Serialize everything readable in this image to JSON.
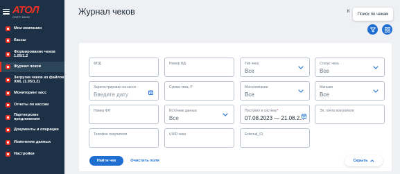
{
  "sidebar": {
    "logo": {
      "main": "АТОЛ",
      "sub": "СБЕР БАНК"
    },
    "items": [
      {
        "label": "Мои компании",
        "icon": "building-icon"
      },
      {
        "label": "Кассы",
        "icon": "register-icon"
      },
      {
        "label": "Формирование чеков 1.05/1.2",
        "icon": "receipt-create-icon"
      },
      {
        "label": "Журнал чеков",
        "icon": "journal-icon",
        "active": true
      },
      {
        "label": "Загрузка чеков из файлов XML (1.05/1.2)",
        "icon": "upload-icon"
      },
      {
        "label": "Мониторинг касс",
        "icon": "monitor-icon"
      },
      {
        "label": "Отчеты по кассам",
        "icon": "report-icon"
      },
      {
        "label": "Партнерские предложения",
        "icon": "partner-icon"
      },
      {
        "label": "Документы и операции",
        "icon": "documents-icon"
      },
      {
        "label": "Изменение данных",
        "icon": "edit-icon"
      },
      {
        "label": "Настройки",
        "icon": "settings-icon"
      }
    ]
  },
  "header": {
    "title": "Журнал чеков",
    "badge": "К",
    "tooltip": "Поиск по чекам"
  },
  "filters": {
    "fd": {
      "label": "ФПД",
      "value": ""
    },
    "fd_number": {
      "label": "Номер ФД",
      "value": ""
    },
    "receipt_type": {
      "label": "Тип чека",
      "value": "Все"
    },
    "receipt_status": {
      "label": "Статус чека",
      "value": "Все"
    },
    "registered_on_register": {
      "label": "Зарегистрирован на кассе",
      "placeholder": "Введите дату"
    },
    "receipt_sum": {
      "label": "Сумма чека, Р",
      "value": ""
    },
    "my_companies": {
      "label": "Мои компании",
      "value": "Все"
    },
    "shops": {
      "label": "Магазин",
      "value": "Все"
    },
    "fn_number": {
      "label": "Номер ФН",
      "value": ""
    },
    "data_sources": {
      "label": "Источник данных",
      "value": "Все"
    },
    "received_in_system": {
      "label": "Поступил в систему",
      "required": "*",
      "value": "07.08.2023 — 21.08.2..."
    },
    "buyer_email": {
      "label": "Эл. почта покупателя",
      "value": ""
    },
    "buyer_phone": {
      "label": "Телефон покупателя",
      "value": ""
    },
    "receipt_uuid": {
      "label": "UUID чека",
      "value": ""
    },
    "external_id": {
      "label": "External_ID",
      "value": ""
    }
  },
  "actions": {
    "find": "Найти чек",
    "clear": "Очистить поля",
    "hide": "Скрыть"
  },
  "colors": {
    "sidebar_bg": "#1c3145",
    "accent": "#1f6fd2",
    "brand_red": "#ef3124"
  }
}
